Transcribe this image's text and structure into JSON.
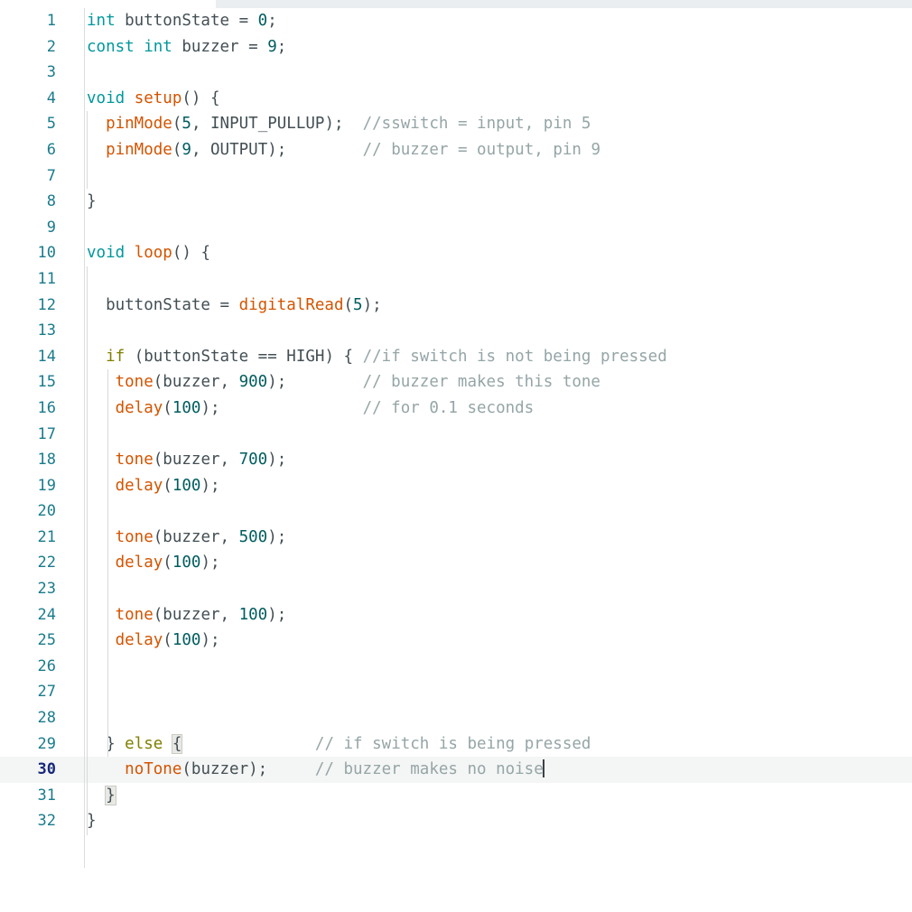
{
  "app": {
    "type": "code-editor",
    "language": "arduino-c",
    "theme_background": "#ffffff",
    "topbar_fill_color": "#eaeef0"
  },
  "editor": {
    "active_line": 30,
    "caret_line": 30,
    "caret_at_end_of_line": true,
    "active_line_background": "#f4f5f5",
    "gutter_color": "#1a7b8c",
    "active_gutter_color": "#16287a",
    "bracket_match_lines": [
      29,
      31
    ],
    "colors": {
      "keyword": "#00979c",
      "control": "#7f7f00",
      "function": "#d35400",
      "number": "#005c5f",
      "comment": "#95a5a6",
      "plain": "#434f54",
      "indent_guide": "#d9d9d9",
      "gutter_separator": "#dcdcdc"
    },
    "line_numbers": [
      1,
      2,
      3,
      4,
      5,
      6,
      7,
      8,
      9,
      10,
      11,
      12,
      13,
      14,
      15,
      16,
      17,
      18,
      19,
      20,
      21,
      22,
      23,
      24,
      25,
      26,
      27,
      28,
      29,
      30,
      31,
      32
    ],
    "lines": [
      {
        "n": 1,
        "text": "int buttonState = 0;"
      },
      {
        "n": 2,
        "text": "const int buzzer = 9;"
      },
      {
        "n": 3,
        "text": ""
      },
      {
        "n": 4,
        "text": "void setup() {"
      },
      {
        "n": 5,
        "text": "  pinMode(5, INPUT_PULLUP);  //sswitch = input, pin 5"
      },
      {
        "n": 6,
        "text": "  pinMode(9, OUTPUT);        // buzzer = output, pin 9"
      },
      {
        "n": 7,
        "text": ""
      },
      {
        "n": 8,
        "text": "}"
      },
      {
        "n": 9,
        "text": ""
      },
      {
        "n": 10,
        "text": "void loop() {"
      },
      {
        "n": 11,
        "text": ""
      },
      {
        "n": 12,
        "text": "  buttonState = digitalRead(5);"
      },
      {
        "n": 13,
        "text": ""
      },
      {
        "n": 14,
        "text": "  if (buttonState == HIGH) { //if switch is not being pressed"
      },
      {
        "n": 15,
        "text": "   tone(buzzer, 900);        // buzzer makes this tone"
      },
      {
        "n": 16,
        "text": "   delay(100);               // for 0.1 seconds"
      },
      {
        "n": 17,
        "text": ""
      },
      {
        "n": 18,
        "text": "   tone(buzzer, 700);"
      },
      {
        "n": 19,
        "text": "   delay(100);"
      },
      {
        "n": 20,
        "text": ""
      },
      {
        "n": 21,
        "text": "   tone(buzzer, 500);"
      },
      {
        "n": 22,
        "text": "   delay(100);"
      },
      {
        "n": 23,
        "text": ""
      },
      {
        "n": 24,
        "text": "   tone(buzzer, 100);"
      },
      {
        "n": 25,
        "text": "   delay(100);"
      },
      {
        "n": 26,
        "text": ""
      },
      {
        "n": 27,
        "text": ""
      },
      {
        "n": 28,
        "text": ""
      },
      {
        "n": 29,
        "text": "  } else {              // if switch is being pressed"
      },
      {
        "n": 30,
        "text": "    noTone(buzzer);     // buzzer makes no noise"
      },
      {
        "n": 31,
        "text": "  }"
      },
      {
        "n": 32,
        "text": "}"
      }
    ],
    "tokens": {
      "l1": {
        "kw": "int",
        "id": " buttonState = ",
        "num": "0",
        "end": ";"
      },
      "l2": {
        "kw1": "const",
        "kw2": "int",
        "id": " buzzer = ",
        "num": "9",
        "end": ";"
      },
      "l4": {
        "kw": "void",
        "fn": "setup",
        "rest": "() {"
      },
      "l5": {
        "indent": "  ",
        "fn": "pinMode",
        "p1": "(",
        "num": "5",
        "p2": ", ",
        "cst": "INPUT_PULLUP",
        "p3": ");",
        "cmt": "  //sswitch = input, pin 5"
      },
      "l6": {
        "indent": "  ",
        "fn": "pinMode",
        "p1": "(",
        "num": "9",
        "p2": ", ",
        "cst": "OUTPUT",
        "p3": ");",
        "cmt": "        // buzzer = output, pin 9"
      },
      "l8": {
        "text": "}"
      },
      "l10": {
        "kw": "void",
        "fn": "loop",
        "rest": "() {"
      },
      "l12": {
        "indent": "  ",
        "id": "buttonState = ",
        "fn": "digitalRead",
        "p1": "(",
        "num": "5",
        "p2": ");"
      },
      "l14": {
        "indent": "  ",
        "ctl": "if",
        "mid": " (buttonState == ",
        "cst": "HIGH",
        "p": ") { ",
        "cmt": "//if switch is not being pressed"
      },
      "l15": {
        "indent": "   ",
        "fn": "tone",
        "p1": "(buzzer, ",
        "num": "900",
        "p2": ");",
        "cmt": "        // buzzer makes this tone"
      },
      "l16": {
        "indent": "   ",
        "fn": "delay",
        "p1": "(",
        "num": "100",
        "p2": ");",
        "cmt": "               // for 0.1 seconds"
      },
      "l18": {
        "indent": "   ",
        "fn": "tone",
        "p1": "(buzzer, ",
        "num": "700",
        "p2": ");"
      },
      "l19": {
        "indent": "   ",
        "fn": "delay",
        "p1": "(",
        "num": "100",
        "p2": ");"
      },
      "l21": {
        "indent": "   ",
        "fn": "tone",
        "p1": "(buzzer, ",
        "num": "500",
        "p2": ");"
      },
      "l22": {
        "indent": "   ",
        "fn": "delay",
        "p1": "(",
        "num": "100",
        "p2": ");"
      },
      "l24": {
        "indent": "   ",
        "fn": "tone",
        "p1": "(buzzer, ",
        "num": "100",
        "p2": ");"
      },
      "l25": {
        "indent": "   ",
        "fn": "delay",
        "p1": "(",
        "num": "100",
        "p2": ");"
      },
      "l29": {
        "indent": "  ",
        "close": "} ",
        "ctl": "else",
        "sp": " ",
        "brace": "{",
        "cmt": "              // if switch is being pressed"
      },
      "l30": {
        "indent": "    ",
        "fn": "noTone",
        "p1": "(buzzer);",
        "cmt": "     // buzzer makes no noise"
      },
      "l31": {
        "indent": "  ",
        "brace": "}"
      },
      "l32": {
        "text": "}"
      }
    }
  }
}
